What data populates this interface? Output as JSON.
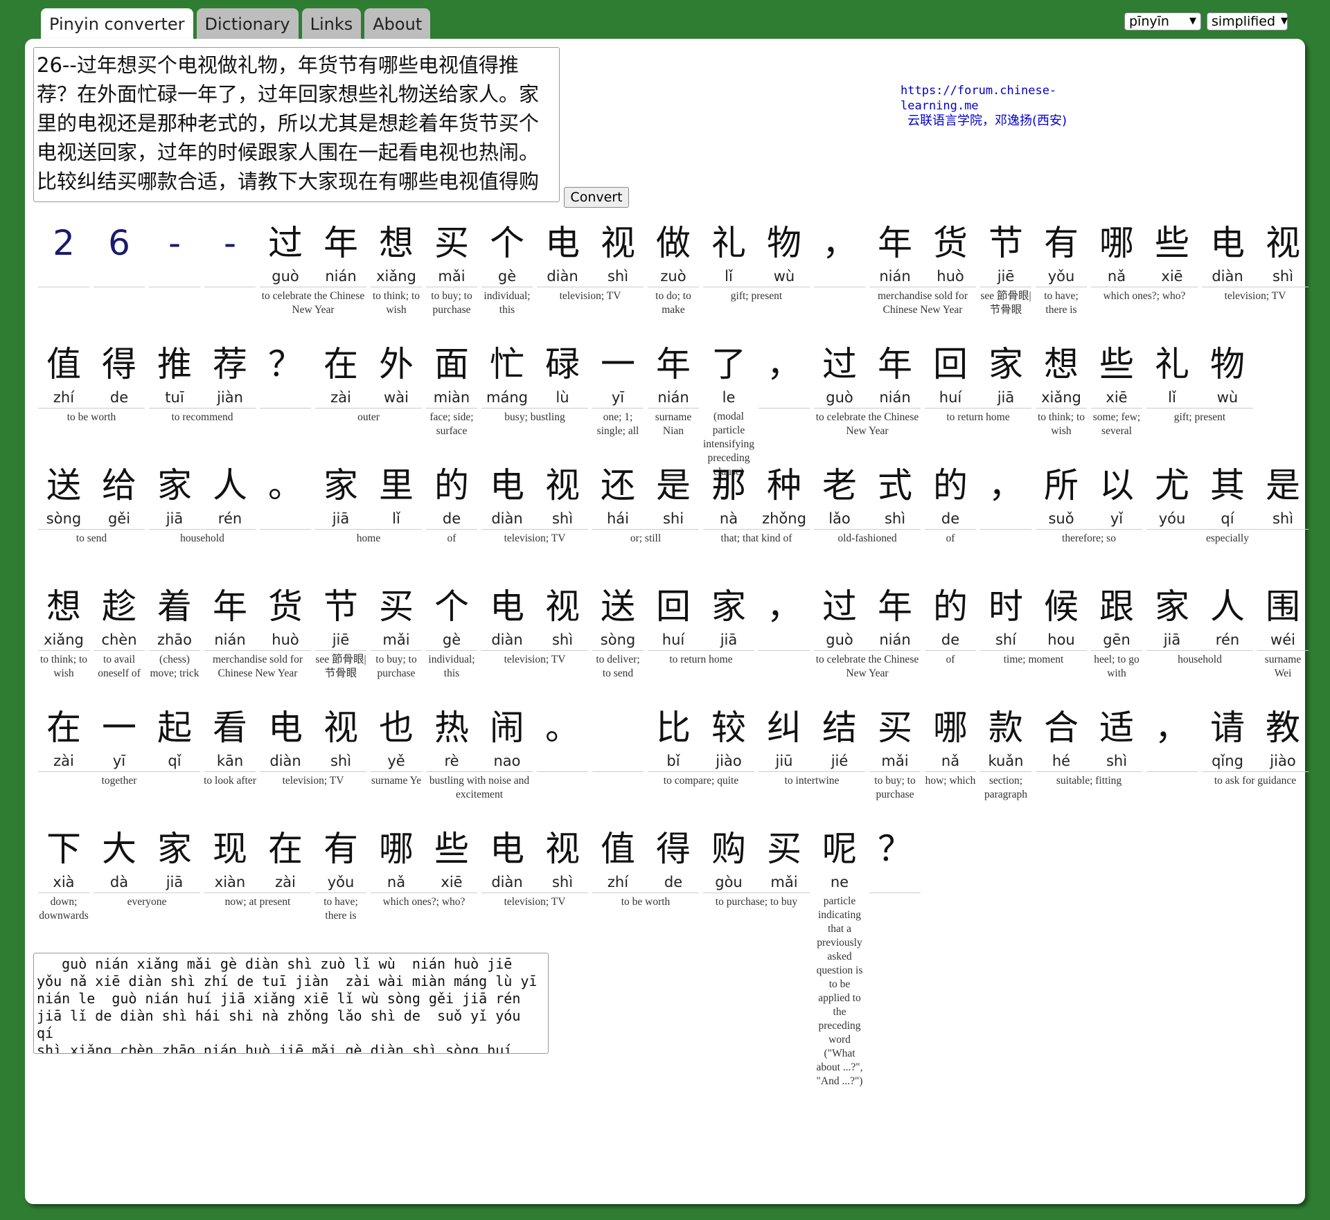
{
  "tabs": [
    "Pinyin converter",
    "Dictionary",
    "Links",
    "About"
  ],
  "controls": {
    "display_mode": "pīnyīn",
    "script": "simplified",
    "convert_label": "Convert"
  },
  "credit": {
    "url": "https://forum.chinese-learning.me",
    "org": "云联语言学院，邓逸扬(西安)"
  },
  "input_text": "26--过年想买个电视做礼物，年货节有哪些电视值得推荐？在外面忙碌一年了，过年回家想些礼物送给家人。家里的电视还是那种老式的，所以尤其是想趁着年货节买个电视送回家，过年的时候跟家人围在一起看电视也热闹。 比较纠结买哪款合适，请教下大家现在有哪些电视值得购买呢",
  "output_text": "   guò nián xiǎng mǎi gè diàn shì zuò lǐ wù  nián huò jiē\nyǒu nǎ xiē diàn shì zhí de tuī jiàn  zài wài miàn máng lù yī\nnián le  guò nián huí jiā xiǎng xiē lǐ wù sòng gěi jiā rén\njiā lǐ de diàn shì hái shi nà zhǒng lǎo shì de  suǒ yǐ yóu qí\nshì xiǎng chèn zhāo nián huò jiē mǎi gè diàn shì sòng huí jiā\nguò nián de shí hou gēn jiā rén wéi zài yī qǐ kān diàn shì yě",
  "rows": [
    [
      {
        "t": [
          {
            "c": "2",
            "p": ""
          }
        ],
        "g": ""
      },
      {
        "t": [
          {
            "c": "6",
            "p": ""
          }
        ],
        "g": ""
      },
      {
        "t": [
          {
            "c": "-",
            "p": ""
          }
        ],
        "g": ""
      },
      {
        "t": [
          {
            "c": "-",
            "p": ""
          }
        ],
        "g": ""
      },
      {
        "t": [
          {
            "c": "过",
            "p": "guò"
          },
          {
            "c": "年",
            "p": "nián"
          }
        ],
        "g": "to celebrate the Chinese New Year"
      },
      {
        "t": [
          {
            "c": "想",
            "p": "xiǎng"
          }
        ],
        "g": "to think; to wish"
      },
      {
        "t": [
          {
            "c": "买",
            "p": "mǎi"
          }
        ],
        "g": "to buy; to purchase"
      },
      {
        "t": [
          {
            "c": "个",
            "p": "gè"
          }
        ],
        "g": "individual; this"
      },
      {
        "t": [
          {
            "c": "电",
            "p": "diàn"
          },
          {
            "c": "视",
            "p": "shì"
          }
        ],
        "g": "television; TV"
      },
      {
        "t": [
          {
            "c": "做",
            "p": "zuò"
          }
        ],
        "g": "to do; to make"
      },
      {
        "t": [
          {
            "c": "礼",
            "p": "lǐ"
          },
          {
            "c": "物",
            "p": "wù"
          }
        ],
        "g": "gift; present"
      },
      {
        "t": [
          {
            "c": "，",
            "p": ""
          }
        ],
        "g": ""
      },
      {
        "t": [
          {
            "c": "年",
            "p": "nián"
          },
          {
            "c": "货",
            "p": "huò"
          }
        ],
        "g": "merchandise sold for Chinese New Year"
      },
      {
        "t": [
          {
            "c": "节",
            "p": "jiē"
          }
        ],
        "g": "see 節骨眼|节骨眼"
      },
      {
        "t": [
          {
            "c": "有",
            "p": "yǒu"
          }
        ],
        "g": "to have; there is"
      },
      {
        "t": [
          {
            "c": "哪",
            "p": "nǎ"
          },
          {
            "c": "些",
            "p": "xiē"
          }
        ],
        "g": "which ones?; who?"
      },
      {
        "t": [
          {
            "c": "电",
            "p": "diàn"
          },
          {
            "c": "视",
            "p": "shì"
          }
        ],
        "g": "television; TV"
      }
    ],
    [
      {
        "t": [
          {
            "c": "值",
            "p": "zhí"
          },
          {
            "c": "得",
            "p": "de"
          }
        ],
        "g": "to be worth"
      },
      {
        "t": [
          {
            "c": "推",
            "p": "tuī"
          },
          {
            "c": "荐",
            "p": "jiàn"
          }
        ],
        "g": "to recommend"
      },
      {
        "t": [
          {
            "c": "？",
            "p": ""
          }
        ],
        "g": ""
      },
      {
        "t": [
          {
            "c": "在",
            "p": "zài"
          },
          {
            "c": "外",
            "p": "wài"
          }
        ],
        "g": "outer"
      },
      {
        "t": [
          {
            "c": "面",
            "p": "miàn"
          }
        ],
        "g": "face; side; surface"
      },
      {
        "t": [
          {
            "c": "忙",
            "p": "máng"
          },
          {
            "c": "碌",
            "p": "lù"
          }
        ],
        "g": "busy; bustling"
      },
      {
        "t": [
          {
            "c": "一",
            "p": "yī"
          }
        ],
        "g": "one; 1; single; all"
      },
      {
        "t": [
          {
            "c": "年",
            "p": "nián"
          }
        ],
        "g": "surname Nian"
      },
      {
        "t": [
          {
            "c": "了",
            "p": "le"
          }
        ],
        "g": "(modal particle intensifying preceding clause)"
      },
      {
        "t": [
          {
            "c": "，",
            "p": ""
          }
        ],
        "g": ""
      },
      {
        "t": [
          {
            "c": "过",
            "p": "guò"
          },
          {
            "c": "年",
            "p": "nián"
          }
        ],
        "g": "to celebrate the Chinese New Year"
      },
      {
        "t": [
          {
            "c": "回",
            "p": "huí"
          },
          {
            "c": "家",
            "p": "jiā"
          }
        ],
        "g": "to return home"
      },
      {
        "t": [
          {
            "c": "想",
            "p": "xiǎng"
          }
        ],
        "g": "to think; to wish"
      },
      {
        "t": [
          {
            "c": "些",
            "p": "xiē"
          }
        ],
        "g": "some; few; several"
      },
      {
        "t": [
          {
            "c": "礼",
            "p": "lǐ"
          },
          {
            "c": "物",
            "p": "wù"
          }
        ],
        "g": "gift; present"
      }
    ],
    [
      {
        "t": [
          {
            "c": "送",
            "p": "sòng"
          },
          {
            "c": "给",
            "p": "gěi"
          }
        ],
        "g": "to send"
      },
      {
        "t": [
          {
            "c": "家",
            "p": "jiā"
          },
          {
            "c": "人",
            "p": "rén"
          }
        ],
        "g": "household"
      },
      {
        "t": [
          {
            "c": "。",
            "p": ""
          }
        ],
        "g": ""
      },
      {
        "t": [
          {
            "c": "家",
            "p": "jiā"
          },
          {
            "c": "里",
            "p": "lǐ"
          }
        ],
        "g": "home"
      },
      {
        "t": [
          {
            "c": "的",
            "p": "de"
          }
        ],
        "g": "of"
      },
      {
        "t": [
          {
            "c": "电",
            "p": "diàn"
          },
          {
            "c": "视",
            "p": "shì"
          }
        ],
        "g": "television; TV"
      },
      {
        "t": [
          {
            "c": "还",
            "p": "hái"
          },
          {
            "c": "是",
            "p": "shi"
          }
        ],
        "g": "or; still"
      },
      {
        "t": [
          {
            "c": "那",
            "p": "nà"
          },
          {
            "c": "种",
            "p": "zhǒng"
          }
        ],
        "g": "that; that kind of"
      },
      {
        "t": [
          {
            "c": "老",
            "p": "lǎo"
          },
          {
            "c": "式",
            "p": "shì"
          }
        ],
        "g": "old-fashioned"
      },
      {
        "t": [
          {
            "c": "的",
            "p": "de"
          }
        ],
        "g": "of"
      },
      {
        "t": [
          {
            "c": "，",
            "p": ""
          }
        ],
        "g": ""
      },
      {
        "t": [
          {
            "c": "所",
            "p": "suǒ"
          },
          {
            "c": "以",
            "p": "yǐ"
          }
        ],
        "g": "therefore; so"
      },
      {
        "t": [
          {
            "c": "尤",
            "p": "yóu"
          },
          {
            "c": "其",
            "p": "qí"
          },
          {
            "c": "是",
            "p": "shì"
          }
        ],
        "g": "especially"
      }
    ],
    [
      {
        "t": [
          {
            "c": "想",
            "p": "xiǎng"
          }
        ],
        "g": "to think; to wish"
      },
      {
        "t": [
          {
            "c": "趁",
            "p": "chèn"
          }
        ],
        "g": "to avail oneself of"
      },
      {
        "t": [
          {
            "c": "着",
            "p": "zhāo"
          }
        ],
        "g": "(chess) move; trick"
      },
      {
        "t": [
          {
            "c": "年",
            "p": "nián"
          },
          {
            "c": "货",
            "p": "huò"
          }
        ],
        "g": "merchandise sold for Chinese New Year"
      },
      {
        "t": [
          {
            "c": "节",
            "p": "jiē"
          }
        ],
        "g": "see 節骨眼|节骨眼"
      },
      {
        "t": [
          {
            "c": "买",
            "p": "mǎi"
          }
        ],
        "g": "to buy; to purchase"
      },
      {
        "t": [
          {
            "c": "个",
            "p": "gè"
          }
        ],
        "g": "individual; this"
      },
      {
        "t": [
          {
            "c": "电",
            "p": "diàn"
          },
          {
            "c": "视",
            "p": "shì"
          }
        ],
        "g": "television; TV"
      },
      {
        "t": [
          {
            "c": "送",
            "p": "sòng"
          }
        ],
        "g": "to deliver; to send"
      },
      {
        "t": [
          {
            "c": "回",
            "p": "huí"
          },
          {
            "c": "家",
            "p": "jiā"
          }
        ],
        "g": "to return home"
      },
      {
        "t": [
          {
            "c": "，",
            "p": ""
          }
        ],
        "g": ""
      },
      {
        "t": [
          {
            "c": "过",
            "p": "guò"
          },
          {
            "c": "年",
            "p": "nián"
          }
        ],
        "g": "to celebrate the Chinese New Year"
      },
      {
        "t": [
          {
            "c": "的",
            "p": "de"
          }
        ],
        "g": "of"
      },
      {
        "t": [
          {
            "c": "时",
            "p": "shí"
          },
          {
            "c": "候",
            "p": "hou"
          }
        ],
        "g": "time; moment"
      },
      {
        "t": [
          {
            "c": "跟",
            "p": "gēn"
          }
        ],
        "g": "heel; to go with"
      },
      {
        "t": [
          {
            "c": "家",
            "p": "jiā"
          },
          {
            "c": "人",
            "p": "rén"
          }
        ],
        "g": "household"
      },
      {
        "t": [
          {
            "c": "围",
            "p": "wéi"
          }
        ],
        "g": "surname Wei"
      }
    ],
    [
      {
        "t": [
          {
            "c": "在",
            "p": "zài"
          },
          {
            "c": "一",
            "p": "yī"
          },
          {
            "c": "起",
            "p": "qǐ"
          }
        ],
        "g": "together"
      },
      {
        "t": [
          {
            "c": "看",
            "p": "kān"
          }
        ],
        "g": "to look after"
      },
      {
        "t": [
          {
            "c": "电",
            "p": "diàn"
          },
          {
            "c": "视",
            "p": "shì"
          }
        ],
        "g": "television; TV"
      },
      {
        "t": [
          {
            "c": "也",
            "p": "yě"
          }
        ],
        "g": "surname Ye"
      },
      {
        "t": [
          {
            "c": "热",
            "p": "rè"
          },
          {
            "c": "闹",
            "p": "nao"
          }
        ],
        "g": "bustling with noise and excitement"
      },
      {
        "t": [
          {
            "c": "。",
            "p": ""
          }
        ],
        "g": ""
      },
      {
        "t": [
          {
            "c": "",
            "p": ""
          }
        ],
        "g": ""
      },
      {
        "t": [
          {
            "c": "比",
            "p": "bǐ"
          },
          {
            "c": "较",
            "p": "jiào"
          }
        ],
        "g": "to compare; quite"
      },
      {
        "t": [
          {
            "c": "纠",
            "p": "jiū"
          },
          {
            "c": "结",
            "p": "jié"
          }
        ],
        "g": "to intertwine"
      },
      {
        "t": [
          {
            "c": "买",
            "p": "mǎi"
          }
        ],
        "g": "to buy; to purchase"
      },
      {
        "t": [
          {
            "c": "哪",
            "p": "nǎ"
          }
        ],
        "g": "how; which"
      },
      {
        "t": [
          {
            "c": "款",
            "p": "kuǎn"
          }
        ],
        "g": "section; paragraph"
      },
      {
        "t": [
          {
            "c": "合",
            "p": "hé"
          },
          {
            "c": "适",
            "p": "shì"
          }
        ],
        "g": "suitable; fitting"
      },
      {
        "t": [
          {
            "c": "，",
            "p": ""
          }
        ],
        "g": ""
      },
      {
        "t": [
          {
            "c": "请",
            "p": "qǐng"
          },
          {
            "c": "教",
            "p": "jiào"
          }
        ],
        "g": "to ask for guidance"
      }
    ],
    [
      {
        "t": [
          {
            "c": "下",
            "p": "xià"
          }
        ],
        "g": "down; downwards"
      },
      {
        "t": [
          {
            "c": "大",
            "p": "dà"
          },
          {
            "c": "家",
            "p": "jiā"
          }
        ],
        "g": "everyone"
      },
      {
        "t": [
          {
            "c": "现",
            "p": "xiàn"
          },
          {
            "c": "在",
            "p": "zài"
          }
        ],
        "g": "now; at present"
      },
      {
        "t": [
          {
            "c": "有",
            "p": "yǒu"
          }
        ],
        "g": "to have; there is"
      },
      {
        "t": [
          {
            "c": "哪",
            "p": "nǎ"
          },
          {
            "c": "些",
            "p": "xiē"
          }
        ],
        "g": "which ones?; who?"
      },
      {
        "t": [
          {
            "c": "电",
            "p": "diàn"
          },
          {
            "c": "视",
            "p": "shì"
          }
        ],
        "g": "television; TV"
      },
      {
        "t": [
          {
            "c": "值",
            "p": "zhí"
          },
          {
            "c": "得",
            "p": "de"
          }
        ],
        "g": "to be worth"
      },
      {
        "t": [
          {
            "c": "购",
            "p": "gòu"
          },
          {
            "c": "买",
            "p": "mǎi"
          }
        ],
        "g": "to purchase; to buy"
      },
      {
        "t": [
          {
            "c": "呢",
            "p": "ne"
          }
        ],
        "g": "particle indicating that a previously asked question is to be applied to the preceding word (\"What about ...?\", \"And ...?\")"
      },
      {
        "t": [
          {
            "c": "？",
            "p": ""
          }
        ],
        "g": ""
      }
    ]
  ]
}
